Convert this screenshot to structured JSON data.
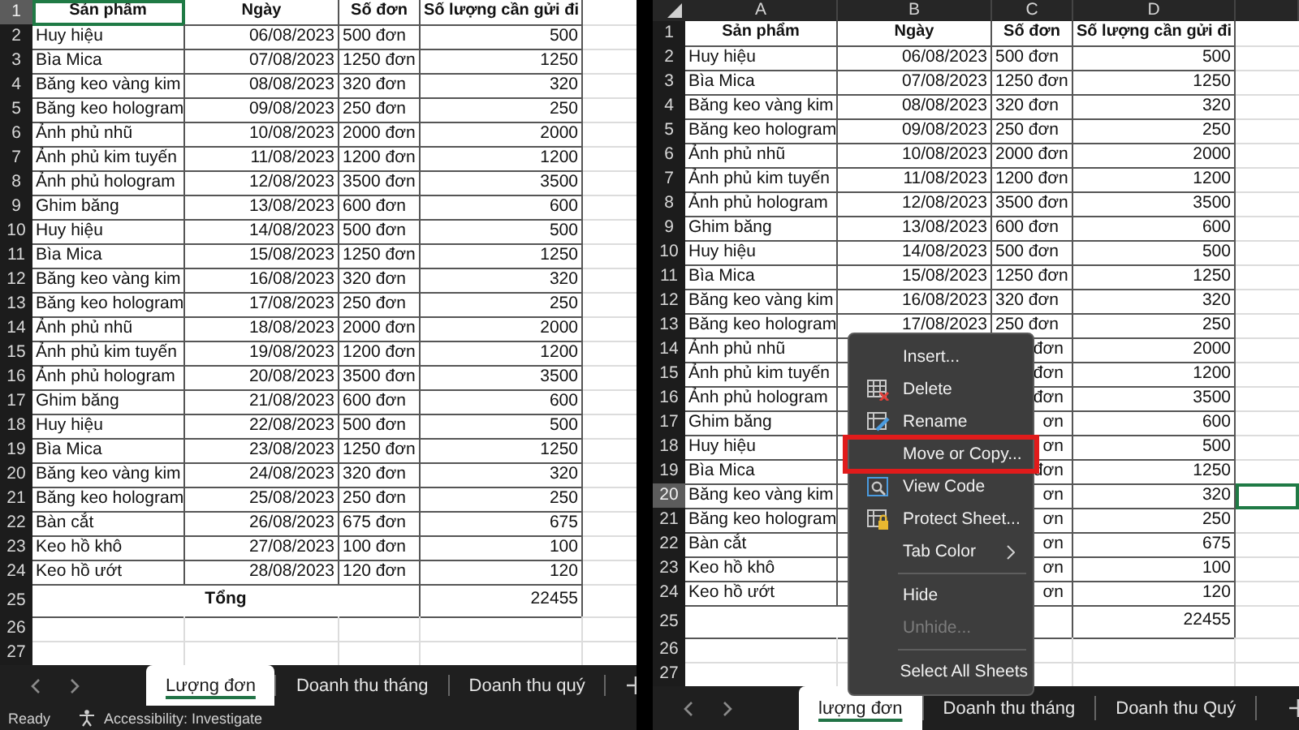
{
  "panels": [
    {
      "rows": [
        {
          "n": "1",
          "kind": "header",
          "a": "Sản phẩm",
          "b": "Ngày",
          "c": "Số đơn",
          "d": "Số lượng cần gửi đi",
          "sel_a": true
        },
        {
          "n": "2",
          "kind": "data",
          "a": "Huy hiệu",
          "b": "06/08/2023",
          "c": "500 đơn",
          "d": "500"
        },
        {
          "n": "3",
          "kind": "data",
          "a": "Bìa Mica",
          "b": "07/08/2023",
          "c": "1250 đơn",
          "d": "1250"
        },
        {
          "n": "4",
          "kind": "data",
          "a": "Băng keo vàng kim",
          "b": "08/08/2023",
          "c": "320 đơn",
          "d": "320"
        },
        {
          "n": "5",
          "kind": "data",
          "a": "Băng keo hologram",
          "b": "09/08/2023",
          "c": "250 đơn",
          "d": "250"
        },
        {
          "n": "6",
          "kind": "data",
          "a": "Ảnh phủ nhũ",
          "b": "10/08/2023",
          "c": "2000 đơn",
          "d": "2000"
        },
        {
          "n": "7",
          "kind": "data",
          "a": "Ảnh phủ kim tuyến",
          "b": "11/08/2023",
          "c": "1200 đơn",
          "d": "1200"
        },
        {
          "n": "8",
          "kind": "data",
          "a": "Ảnh phủ hologram",
          "b": "12/08/2023",
          "c": "3500 đơn",
          "d": "3500"
        },
        {
          "n": "9",
          "kind": "data",
          "a": "Ghim băng",
          "b": "13/08/2023",
          "c": "600 đơn",
          "d": "600"
        },
        {
          "n": "10",
          "kind": "data",
          "a": "Huy hiệu",
          "b": "14/08/2023",
          "c": "500 đơn",
          "d": "500"
        },
        {
          "n": "11",
          "kind": "data",
          "a": "Bìa Mica",
          "b": "15/08/2023",
          "c": "1250 đơn",
          "d": "1250"
        },
        {
          "n": "12",
          "kind": "data",
          "a": "Băng keo vàng kim",
          "b": "16/08/2023",
          "c": "320 đơn",
          "d": "320"
        },
        {
          "n": "13",
          "kind": "data",
          "a": "Băng keo hologram",
          "b": "17/08/2023",
          "c": "250 đơn",
          "d": "250"
        },
        {
          "n": "14",
          "kind": "data",
          "a": "Ảnh phủ nhũ",
          "b": "18/08/2023",
          "c": "2000 đơn",
          "d": "2000"
        },
        {
          "n": "15",
          "kind": "data",
          "a": "Ảnh phủ kim tuyến",
          "b": "19/08/2023",
          "c": "1200 đơn",
          "d": "1200"
        },
        {
          "n": "16",
          "kind": "data",
          "a": "Ảnh phủ hologram",
          "b": "20/08/2023",
          "c": "3500 đơn",
          "d": "3500"
        },
        {
          "n": "17",
          "kind": "data",
          "a": "Ghim băng",
          "b": "21/08/2023",
          "c": "600 đơn",
          "d": "600"
        },
        {
          "n": "18",
          "kind": "data",
          "a": "Huy hiệu",
          "b": "22/08/2023",
          "c": "500 đơn",
          "d": "500"
        },
        {
          "n": "19",
          "kind": "data",
          "a": "Bìa Mica",
          "b": "23/08/2023",
          "c": "1250 đơn",
          "d": "1250"
        },
        {
          "n": "20",
          "kind": "data",
          "a": "Băng keo vàng kim",
          "b": "24/08/2023",
          "c": "320 đơn",
          "d": "320"
        },
        {
          "n": "21",
          "kind": "data",
          "a": "Băng keo hologram",
          "b": "25/08/2023",
          "c": "250 đơn",
          "d": "250"
        },
        {
          "n": "22",
          "kind": "data",
          "a": "Bàn cắt",
          "b": "26/08/2023",
          "c": "675 đơn",
          "d": "675"
        },
        {
          "n": "23",
          "kind": "data",
          "a": "Keo hồ khô",
          "b": "27/08/2023",
          "c": "100 đơn",
          "d": "100"
        },
        {
          "n": "24",
          "kind": "data",
          "a": "Keo hồ ướt",
          "b": "28/08/2023",
          "c": "120 đơn",
          "d": "120"
        },
        {
          "n": "25",
          "kind": "total",
          "a": "Tổng",
          "d": "22455"
        },
        {
          "n": "26",
          "kind": "empty"
        },
        {
          "n": "27",
          "kind": "empty"
        }
      ],
      "tabs": [
        {
          "label": "Lượng đơn",
          "selected": true
        },
        {
          "label": "Doanh thu tháng",
          "selected": false
        },
        {
          "label": "Doanh thu quý",
          "selected": false
        }
      ],
      "status_bar": {
        "state": "Ready",
        "accessibility": "Accessibility: Investigate"
      }
    },
    {
      "column_headers": [
        "A",
        "B",
        "C",
        "D"
      ],
      "rows": [
        {
          "n": "1",
          "kind": "header",
          "a": "Sản phẩm",
          "b": "Ngày",
          "c": "Số đơn",
          "d": "Số lượng cần gửi đi"
        },
        {
          "n": "2",
          "kind": "data",
          "a": "Huy hiệu",
          "b": "06/08/2023",
          "c": "500 đơn",
          "d": "500"
        },
        {
          "n": "3",
          "kind": "data",
          "a": "Bìa Mica",
          "b": "07/08/2023",
          "c": "1250 đơn",
          "d": "1250"
        },
        {
          "n": "4",
          "kind": "data",
          "a": "Băng keo vàng kim",
          "b": "08/08/2023",
          "c": "320 đơn",
          "d": "320"
        },
        {
          "n": "5",
          "kind": "data",
          "a": "Băng keo hologram",
          "b": "09/08/2023",
          "c": "250 đơn",
          "d": "250"
        },
        {
          "n": "6",
          "kind": "data",
          "a": "Ảnh phủ nhũ",
          "b": "10/08/2023",
          "c": "2000 đơn",
          "d": "2000"
        },
        {
          "n": "7",
          "kind": "data",
          "a": "Ảnh phủ kim tuyến",
          "b": "11/08/2023",
          "c": "1200 đơn",
          "d": "1200"
        },
        {
          "n": "8",
          "kind": "data",
          "a": "Ảnh phủ hologram",
          "b": "12/08/2023",
          "c": "3500 đơn",
          "d": "3500"
        },
        {
          "n": "9",
          "kind": "data",
          "a": "Ghim băng",
          "b": "13/08/2023",
          "c": "600 đơn",
          "d": "600"
        },
        {
          "n": "10",
          "kind": "data",
          "a": "Huy hiệu",
          "b": "14/08/2023",
          "c": "500 đơn",
          "d": "500"
        },
        {
          "n": "11",
          "kind": "data",
          "a": "Bìa Mica",
          "b": "15/08/2023",
          "c": "1250 đơn",
          "d": "1250"
        },
        {
          "n": "12",
          "kind": "data",
          "a": "Băng keo vàng kim",
          "b": "16/08/2023",
          "c": "320 đơn",
          "d": "320"
        },
        {
          "n": "13",
          "kind": "data",
          "a": "Băng keo hologram",
          "b": "17/08/2023",
          "c": "250 đơn",
          "d": "250"
        },
        {
          "n": "14",
          "kind": "partial",
          "a": "Ảnh phủ nhũ",
          "c": "đơn",
          "d": "2000"
        },
        {
          "n": "15",
          "kind": "partial",
          "a": "Ảnh phủ kim tuyến",
          "c": "đơn",
          "d": "1200"
        },
        {
          "n": "16",
          "kind": "partial",
          "a": "Ảnh phủ hologram",
          "c": "đơn",
          "d": "3500"
        },
        {
          "n": "17",
          "kind": "partial",
          "a": "Ghim băng",
          "c": "ơn",
          "d": "600"
        },
        {
          "n": "18",
          "kind": "partial",
          "a": "Huy hiệu",
          "c": "ơn",
          "d": "500"
        },
        {
          "n": "19",
          "kind": "partial",
          "a": "Bìa Mica",
          "c": "đơn",
          "d": "1250"
        },
        {
          "n": "20",
          "kind": "partial",
          "a": "Băng keo vàng kim",
          "c": "ơn",
          "d": "320",
          "sel_e": true
        },
        {
          "n": "21",
          "kind": "partial",
          "a": "Băng keo hologram",
          "c": "ơn",
          "d": "250"
        },
        {
          "n": "22",
          "kind": "partial",
          "a": "Bàn cắt",
          "c": "ơn",
          "d": "675"
        },
        {
          "n": "23",
          "kind": "partial",
          "a": "Keo hồ khô",
          "c": "ơn",
          "d": "100"
        },
        {
          "n": "24",
          "kind": "partial",
          "a": "Keo hồ ướt",
          "c": "ơn",
          "d": "120"
        },
        {
          "n": "25",
          "kind": "total",
          "d": "22455"
        },
        {
          "n": "26",
          "kind": "empty"
        },
        {
          "n": "27",
          "kind": "empty"
        }
      ],
      "tabs": [
        {
          "label": "lượng đơn",
          "selected": true
        },
        {
          "label": "Doanh thu tháng",
          "selected": false
        },
        {
          "label": "Doanh thu Quý",
          "selected": false
        }
      ],
      "context_menu": {
        "items": [
          {
            "kind": "item",
            "label": "Insert...",
            "disabled": false,
            "highlighted": false,
            "submenu": false
          },
          {
            "kind": "item",
            "label": "Delete",
            "disabled": false,
            "highlighted": false,
            "submenu": false
          },
          {
            "kind": "item",
            "label": "Rename",
            "disabled": false,
            "highlighted": false,
            "submenu": false
          },
          {
            "kind": "item",
            "label": "Move or Copy...",
            "disabled": false,
            "highlighted": true,
            "submenu": false
          },
          {
            "kind": "item",
            "label": "View Code",
            "disabled": false,
            "highlighted": false,
            "submenu": false
          },
          {
            "kind": "item",
            "label": "Protect Sheet...",
            "disabled": false,
            "highlighted": false,
            "submenu": false
          },
          {
            "kind": "item",
            "label": "Tab Color",
            "disabled": false,
            "highlighted": false,
            "submenu": true
          },
          {
            "kind": "separator"
          },
          {
            "kind": "item",
            "label": "Hide",
            "disabled": false,
            "highlighted": false,
            "submenu": false
          },
          {
            "kind": "item",
            "label": "Unhide...",
            "disabled": true,
            "highlighted": false,
            "submenu": false
          },
          {
            "kind": "separator"
          },
          {
            "kind": "item",
            "label": "Select All Sheets",
            "disabled": false,
            "highlighted": false,
            "submenu": false
          }
        ]
      }
    }
  ]
}
